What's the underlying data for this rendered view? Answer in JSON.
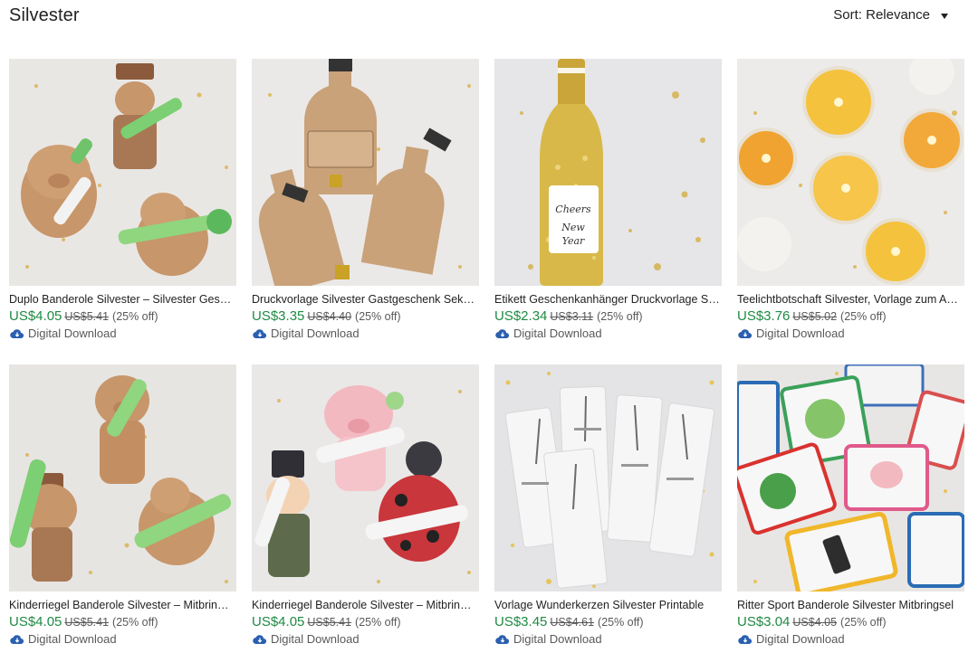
{
  "header": {
    "title": "Silvester",
    "sort_label": "Sort: Relevance"
  },
  "colors": {
    "price": "#1e8a43",
    "muted_text": "#595959",
    "download_icon": "#2b5fb0"
  },
  "products": [
    {
      "title": "Duplo Banderole Silvester – Silvester Geschenk",
      "price": "US$4.05",
      "original_price": "US$5.41",
      "discount": "(25% off)",
      "badge": "Digital Download",
      "image_icon": "pig-chimney-sweep-beetle-craft-image"
    },
    {
      "title": "Druckvorlage Silvester Gastgeschenk Sektflasche",
      "price": "US$3.35",
      "original_price": "US$4.40",
      "discount": "(25% off)",
      "badge": "Digital Download",
      "image_icon": "champagne-bottle-tags-image"
    },
    {
      "title": "Etikett Geschenkanhänger Druckvorlage Sekt",
      "price": "US$2.34",
      "original_price": "US$3.11",
      "discount": "(25% off)",
      "badge": "Digital Download",
      "image_icon": "gold-glitter-champagne-image"
    },
    {
      "title": "Teelichtbotschaft Silvester, Vorlage zum Ausdrucken",
      "price": "US$3.76",
      "original_price": "US$5.02",
      "discount": "(25% off)",
      "badge": "Digital Download",
      "image_icon": "tealight-candles-image"
    },
    {
      "title": "Kinderriegel Banderole Silvester – Mitbringsel",
      "price": "US$4.05",
      "original_price": "US$5.41",
      "discount": "(25% off)",
      "badge": "Digital Download",
      "image_icon": "kraft-pig-chimney-sweep-image"
    },
    {
      "title": "Kinderriegel Banderole Silvester – Mitbringsel",
      "price": "US$4.05",
      "original_price": "US$5.41",
      "discount": "(25% off)",
      "badge": "Digital Download",
      "image_icon": "watercolor-pig-ladybug-image"
    },
    {
      "title": "Vorlage Wunderkerzen Silvester Printable",
      "price": "US$3.45",
      "original_price": "US$4.61",
      "discount": "(25% off)",
      "badge": "Digital Download",
      "image_icon": "sparkler-cards-image"
    },
    {
      "title": "Ritter Sport Banderole Silvester Mitbringsel",
      "price": "US$3.04",
      "original_price": "US$4.05",
      "discount": "(25% off)",
      "badge": "Digital Download",
      "image_icon": "chocolate-wrappers-image"
    }
  ]
}
